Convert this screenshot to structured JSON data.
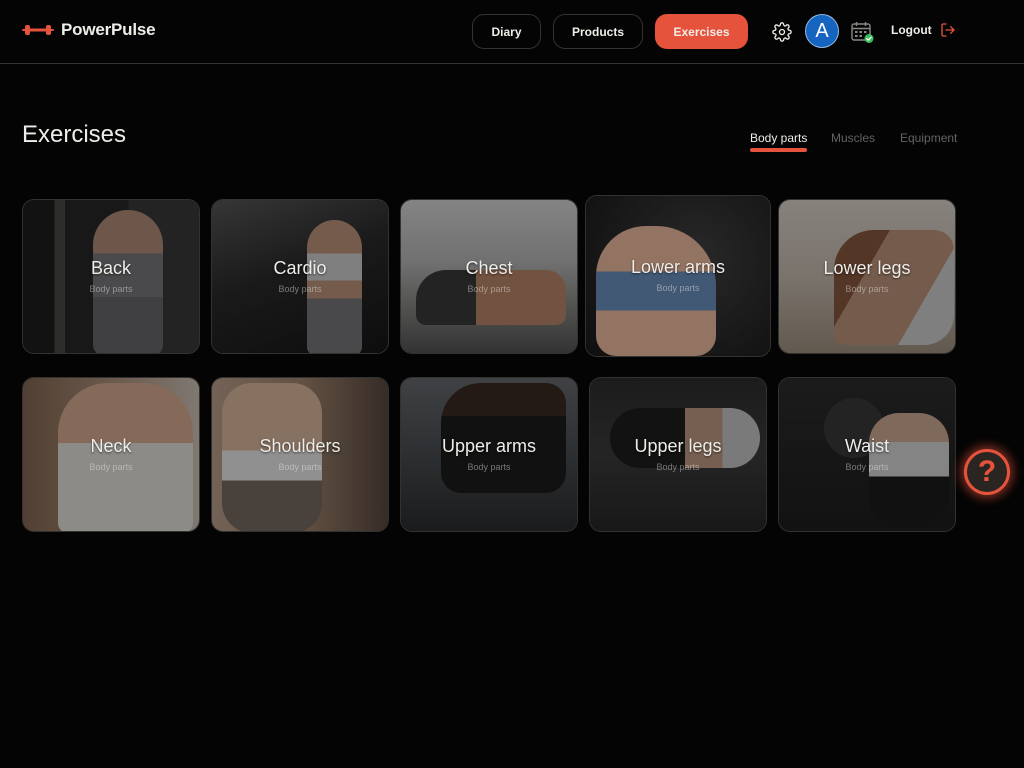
{
  "brand": {
    "name": "PowerPulse",
    "logo_icon": "dumbbell-icon",
    "accent": "#e6533c"
  },
  "nav": {
    "diary": "Diary",
    "products": "Products",
    "exercises": "Exercises",
    "active": "Exercises"
  },
  "user": {
    "initial": "A",
    "avatar_color": "#1565c0"
  },
  "header_icons": [
    "gear-icon",
    "calendar-check-icon",
    "logout-icon"
  ],
  "logout_label": "Logout",
  "page": {
    "title": "Exercises"
  },
  "tabs": [
    {
      "label": "Body parts",
      "active": true
    },
    {
      "label": "Muscles",
      "active": false
    },
    {
      "label": "Equipment",
      "active": false
    }
  ],
  "cards": [
    {
      "title": "Back",
      "subtitle": "Body parts"
    },
    {
      "title": "Cardio",
      "subtitle": "Body parts"
    },
    {
      "title": "Chest",
      "subtitle": "Body parts"
    },
    {
      "title": "Lower arms",
      "subtitle": "Body parts"
    },
    {
      "title": "Lower legs",
      "subtitle": "Body parts"
    },
    {
      "title": "Neck",
      "subtitle": "Body parts"
    },
    {
      "title": "Shoulders",
      "subtitle": "Body parts"
    },
    {
      "title": "Upper arms",
      "subtitle": "Body parts"
    },
    {
      "title": "Upper legs",
      "subtitle": "Body parts"
    },
    {
      "title": "Waist",
      "subtitle": "Body parts"
    }
  ],
  "help": {
    "icon": "help-icon",
    "glyph": "?"
  }
}
